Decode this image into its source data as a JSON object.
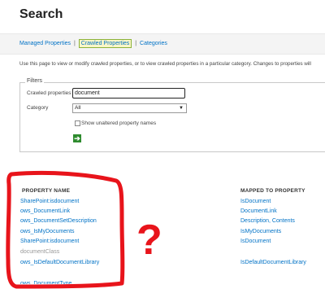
{
  "page": {
    "title": "Search"
  },
  "tabs": [
    {
      "label": "Managed Properties",
      "active": false
    },
    {
      "label": "Crawled Properties",
      "active": true
    },
    {
      "label": "Categories",
      "active": false
    }
  ],
  "tab_separator": "|",
  "intro_text": "Use this page to view or modify crawled properties, or to view crawled properties in a particular category. Changes to properties will",
  "filters": {
    "legend": "Filters",
    "crawled_label": "Crawled properties",
    "crawled_value": "document",
    "category_label": "Category",
    "category_value": "All",
    "checkbox_label": "Show unaltered property names",
    "checkbox_checked": false
  },
  "table": {
    "headers": [
      "PROPERTY NAME",
      "MAPPED TO PROPERTY"
    ],
    "rows": [
      {
        "name": "SharePoint:isdocument",
        "mapped": "IsDocument",
        "name_link": true
      },
      {
        "name": "ows_DocumentLink",
        "mapped": "DocumentLink",
        "name_link": true
      },
      {
        "name": "ows_DocumentSetDescription",
        "mapped": "Description, Contents",
        "name_link": true
      },
      {
        "name": "ows_IsMyDocuments",
        "mapped": "IsMyDocuments",
        "name_link": true
      },
      {
        "name": "SharePoint:isdocument",
        "mapped": "IsDocument",
        "name_link": true
      },
      {
        "name": "documentClass",
        "mapped": "",
        "name_link": false
      },
      {
        "name": "ows_IsDefaultDocumentLibrary",
        "mapped": "IsDefaultDocumentLibrary",
        "name_link": true
      },
      {
        "name": "ows_DocumentType",
        "mapped": "",
        "name_link": true
      }
    ]
  },
  "annotation": {
    "color": "#e8141b",
    "mark": "?"
  },
  "colors": {
    "link": "#0072c6",
    "active_tab_border": "#8db33b",
    "go_button": "#2e8b2e"
  }
}
